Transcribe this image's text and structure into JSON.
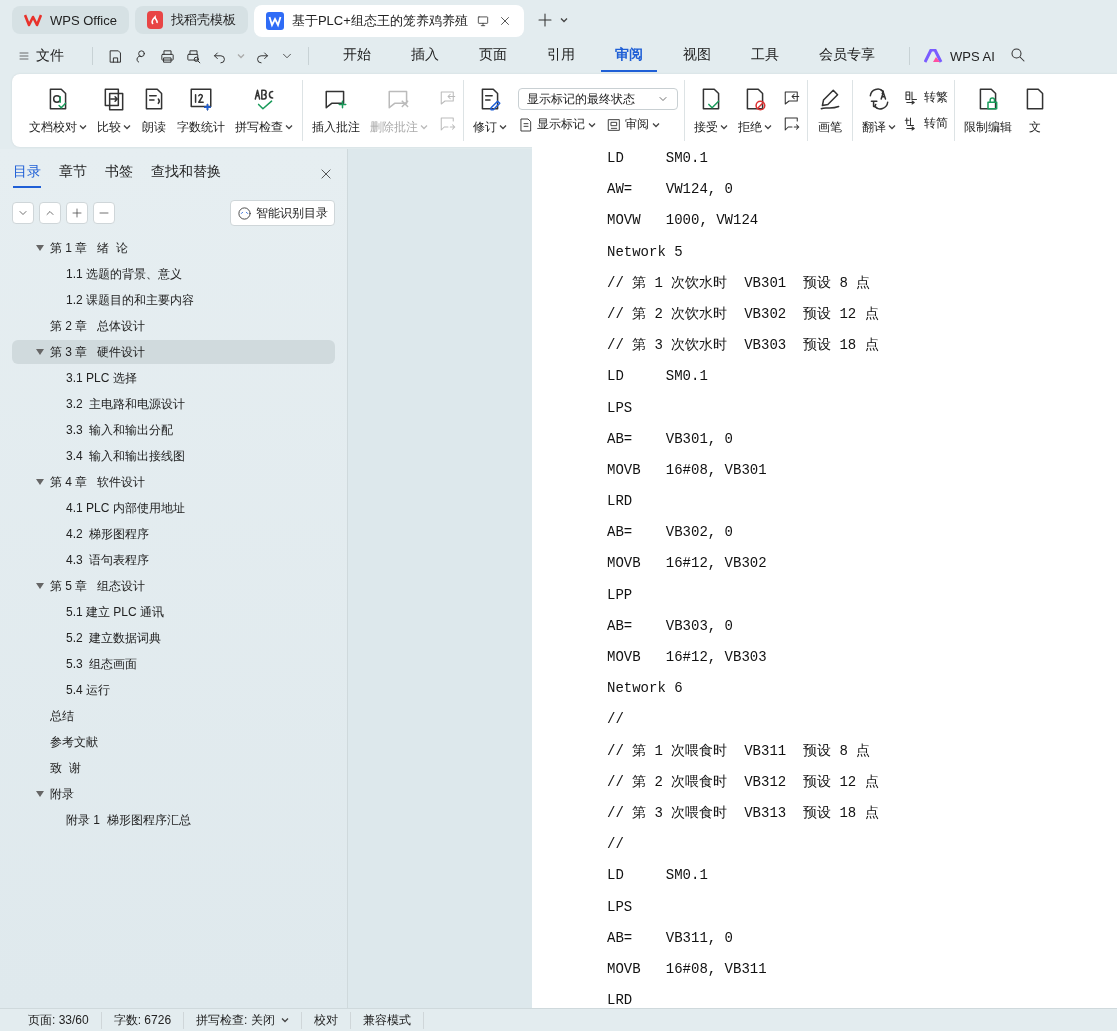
{
  "window_tabs": [
    {
      "kind": "home",
      "label": "WPS Office",
      "selected": false
    },
    {
      "kind": "template",
      "label": "找稻壳模板",
      "selected": false
    },
    {
      "kind": "document",
      "label": "基于PLC+组态王的笼养鸡养殖",
      "selected": true
    }
  ],
  "menu_bar": {
    "file": "文件",
    "tabs": [
      {
        "label": "开始",
        "selected": false
      },
      {
        "label": "插入",
        "selected": false
      },
      {
        "label": "页面",
        "selected": false
      },
      {
        "label": "引用",
        "selected": false
      },
      {
        "label": "审阅",
        "selected": true
      },
      {
        "label": "视图",
        "selected": false
      },
      {
        "label": "工具",
        "selected": false
      },
      {
        "label": "会员专享",
        "selected": false
      }
    ],
    "ai": "WPS AI"
  },
  "ribbon": [
    {
      "items": [
        {
          "kind": "large",
          "label": "文档校对",
          "dropdown": true,
          "disabled": false
        },
        {
          "kind": "large",
          "label": "比较",
          "dropdown": true,
          "disabled": false
        },
        {
          "kind": "large",
          "label": "朗读",
          "dropdown": false,
          "disabled": false
        },
        {
          "kind": "large",
          "label": "字数统计",
          "dropdown": false,
          "disabled": false
        },
        {
          "kind": "large",
          "label": "拼写检查",
          "dropdown": true,
          "disabled": false
        }
      ]
    },
    {
      "items": [
        {
          "kind": "large",
          "label": "插入批注",
          "dropdown": false,
          "disabled": false
        },
        {
          "kind": "large",
          "label": "删除批注",
          "dropdown": true,
          "disabled": true
        },
        {
          "kind": "stack",
          "buttons": [
            {
              "disabled": true
            },
            {
              "disabled": true
            }
          ]
        }
      ]
    },
    {
      "items": [
        {
          "kind": "large",
          "label": "修订",
          "dropdown": true,
          "disabled": false
        },
        {
          "kind": "panel",
          "select": "显示标记的最终状态",
          "buttons": [
            {
              "label": "显示标记",
              "dropdown": true
            },
            {
              "label": "审阅",
              "dropdown": true
            }
          ]
        }
      ]
    },
    {
      "items": [
        {
          "kind": "large",
          "label": "接受",
          "dropdown": true,
          "disabled": false
        },
        {
          "kind": "large",
          "label": "拒绝",
          "dropdown": true,
          "disabled": false
        },
        {
          "kind": "stack",
          "buttons": [
            {
              "disabled": false
            },
            {
              "disabled": false
            }
          ]
        }
      ]
    },
    {
      "items": [
        {
          "kind": "large",
          "label": "画笔",
          "dropdown": false,
          "disabled": false
        }
      ]
    },
    {
      "items": [
        {
          "kind": "large",
          "label": "翻译",
          "dropdown": true,
          "disabled": false
        },
        {
          "kind": "column",
          "buttons": [
            {
              "label": "转繁"
            },
            {
              "label": "转简"
            }
          ]
        }
      ]
    },
    {
      "items": [
        {
          "kind": "large",
          "label": "限制编辑",
          "dropdown": false,
          "disabled": false
        },
        {
          "kind": "large",
          "label": "文",
          "dropdown": false,
          "disabled": false
        }
      ]
    }
  ],
  "sidebar": {
    "tabs": [
      {
        "label": "目录",
        "selected": true
      },
      {
        "label": "章节",
        "selected": false
      },
      {
        "label": "书签",
        "selected": false
      },
      {
        "label": "查找和替换",
        "selected": false
      }
    ],
    "smart_button": "智能识别目录",
    "outline": [
      {
        "label": "第 1 章   绪  论",
        "selected": false,
        "expanded": true,
        "children": [
          {
            "label": "1.1 选题的背景、意义",
            "selected": false
          },
          {
            "label": "1.2 课题目的和主要内容",
            "selected": false
          }
        ]
      },
      {
        "label": "第 2 章   总体设计",
        "selected": false
      },
      {
        "label": "第 3 章   硬件设计",
        "selected": true,
        "expanded": true,
        "children": [
          {
            "label": "3.1 PLC 选择",
            "selected": false
          },
          {
            "label": "3.2  主电路和电源设计",
            "selected": false
          },
          {
            "label": "3.3  输入和输出分配",
            "selected": false
          },
          {
            "label": "3.4  输入和输出接线图",
            "selected": false
          }
        ]
      },
      {
        "label": "第 4 章   软件设计",
        "selected": false,
        "expanded": true,
        "children": [
          {
            "label": "4.1 PLC 内部使用地址",
            "selected": false
          },
          {
            "label": "4.2  梯形图程序",
            "selected": false
          },
          {
            "label": "4.3  语句表程序",
            "selected": false
          }
        ]
      },
      {
        "label": "第 5 章   组态设计",
        "selected": false,
        "expanded": true,
        "children": [
          {
            "label": "5.1 建立 PLC 通讯",
            "selected": false
          },
          {
            "label": "5.2  建立数据词典",
            "selected": false
          },
          {
            "label": "5.3  组态画面",
            "selected": false
          },
          {
            "label": "5.4 运行",
            "selected": false
          }
        ]
      },
      {
        "label": "总结",
        "selected": false
      },
      {
        "label": "参考文献",
        "selected": false
      },
      {
        "label": "致  谢",
        "selected": false
      },
      {
        "label": "附录",
        "selected": false,
        "expanded": true,
        "children": [
          {
            "label": "附录 1  梯形图程序汇总",
            "selected": false
          }
        ]
      }
    ]
  },
  "document": {
    "lines": [
      "LD     SM0.1",
      "AW=    VW124, 0",
      "MOVW   1000, VW124",
      "Network 5",
      "// 第 1 次饮水时  VB301  预设 8 点",
      "// 第 2 次饮水时  VB302  预设 12 点",
      "// 第 3 次饮水时  VB303  预设 18 点",
      "LD     SM0.1",
      "LPS",
      "AB=    VB301, 0",
      "MOVB   16#08, VB301",
      "LRD",
      "AB=    VB302, 0",
      "MOVB   16#12, VB302",
      "LPP",
      "AB=    VB303, 0",
      "MOVB   16#12, VB303",
      "Network 6",
      "//",
      "// 第 1 次喂食时  VB311  预设 8 点",
      "// 第 2 次喂食时  VB312  预设 12 点",
      "// 第 3 次喂食时  VB313  预设 18 点",
      "//",
      "LD     SM0.1",
      "LPS",
      "AB=    VB311, 0",
      "MOVB   16#08, VB311",
      "LRD"
    ]
  },
  "status_bar": [
    {
      "label": "页面: 33/60",
      "dropdown": false
    },
    {
      "label": "字数: 6726",
      "dropdown": false
    },
    {
      "label": "拼写检查: 关闭",
      "dropdown": true
    },
    {
      "label": "校对",
      "dropdown": false
    },
    {
      "label": "兼容模式",
      "dropdown": false
    }
  ]
}
